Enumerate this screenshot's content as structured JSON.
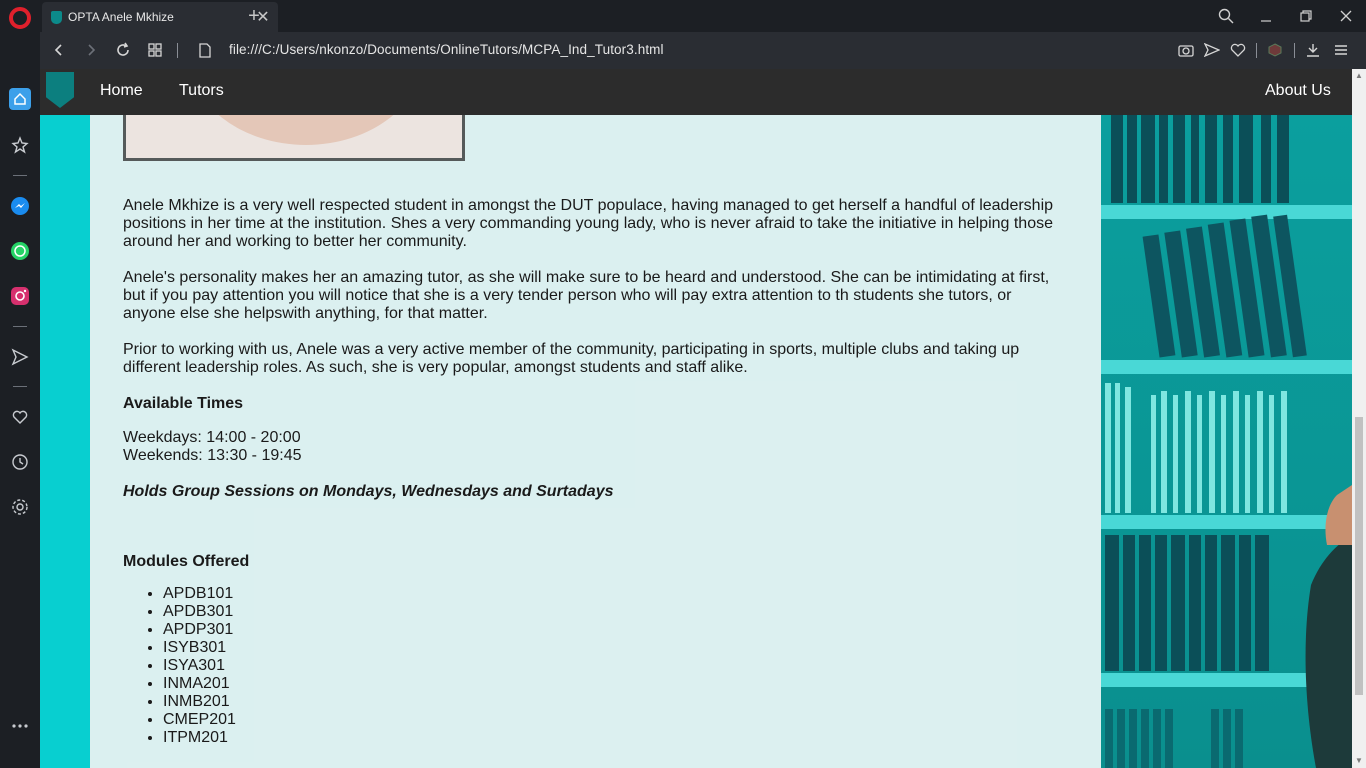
{
  "browser": {
    "tab_title": "OPTA Anele Mkhize",
    "url": "file:///C:/Users/nkonzo/Documents/OnlineTutors/MCPA_Ind_Tutor3.html"
  },
  "navbar": {
    "links": [
      "Home",
      "Tutors",
      "About Us"
    ]
  },
  "profile": {
    "paragraphs": [
      "Anele Mkhize is a very well respected student in amongst the DUT populace, having managed to get herself a handful of leadership positions in her time at the institution. Shes a very commanding young lady, who is never afraid to take the initiative in helping those around her and working to better her community.",
      "Anele's personality makes her an amazing tutor, as she will make sure to be heard and understood. She can be intimidating at first, but if you pay attention you will notice that she is a very tender person who will pay extra attention to th students she tutors, or anyone else she helpswith anything, for that matter.",
      "Prior to working with us, Anele was a very active member of the community, participating in sports, multiple clubs and taking up different leadership roles. As such, she is very popular, amongst students and staff alike."
    ],
    "available_heading": "Available Times",
    "weekdays": "Weekdays: 14:00 - 20:00",
    "weekends": "Weekends: 13:30 - 19:45",
    "group_sessions": "Holds Group Sessions on Mondays, Wednesdays and Surtadays",
    "modules_heading": "Modules Offered",
    "modules": [
      "APDB101",
      "APDB301",
      "APDP301",
      "ISYB301",
      "ISYA301",
      "INMA201",
      "INMB201",
      "CMEP201",
      "ITPM201"
    ]
  },
  "colors": {
    "accent": "#08cfd0",
    "navbar": "#2c2c2c",
    "browser_chrome": "#1c1f24"
  }
}
